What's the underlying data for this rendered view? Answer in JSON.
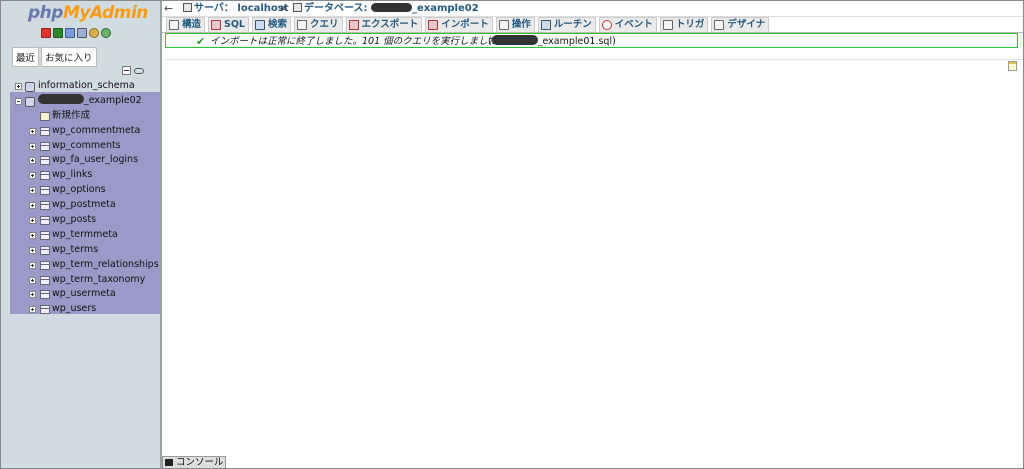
{
  "logo": {
    "part1": "php",
    "part2": "My",
    "part3": "Admin"
  },
  "quick_icons": [
    "home-icon",
    "sql-icon",
    "docs-icon",
    "docs2-icon",
    "settings-icon",
    "reload-icon"
  ],
  "nav_tabs": {
    "recent": "最近",
    "favorites": "お気に入り"
  },
  "tree": {
    "db1": "information_schema",
    "db2_suffix": "_example02",
    "new_item": "新規作成",
    "tables": [
      "wp_commentmeta",
      "wp_comments",
      "wp_fa_user_logins",
      "wp_links",
      "wp_options",
      "wp_postmeta",
      "wp_posts",
      "wp_termmeta",
      "wp_terms",
      "wp_term_relationships",
      "wp_term_taxonomy",
      "wp_usermeta",
      "wp_users"
    ]
  },
  "breadcrumb": {
    "back": "←",
    "server_label": "サーバ：",
    "server_value": "localhost",
    "sep": "»",
    "db_label": "データベース:",
    "db_suffix": "_example02"
  },
  "tabs": [
    "構造",
    "SQL",
    "検索",
    "クエリ",
    "エクスポート",
    "インポート",
    "操作",
    "ルーチン",
    "イベント",
    "トリガ",
    "デザイナ"
  ],
  "message": {
    "text": "インポートは正常に終了しました。101 個のクエリを実行しました。",
    "file_prefix": "(",
    "file_suffix": "_example01.sql)"
  },
  "console": {
    "label": "コンソール"
  }
}
